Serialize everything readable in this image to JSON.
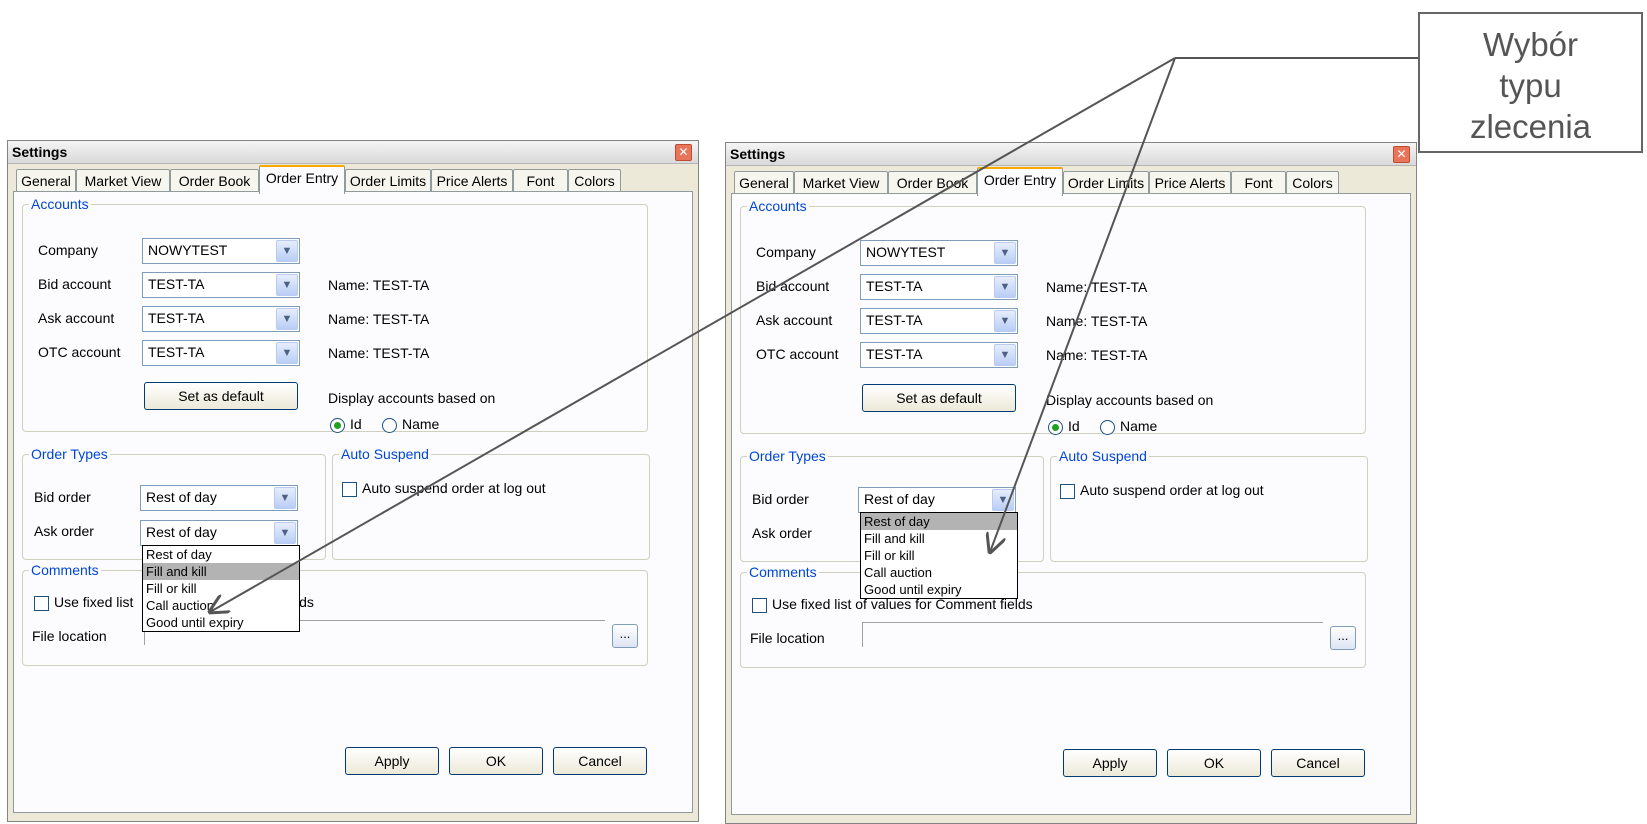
{
  "callout": {
    "line1": "Wybór",
    "line2": "typu",
    "line3": "zlecenia"
  },
  "dialogs": [
    {
      "title": "Settings",
      "close_glyph": "✕",
      "tabs": [
        "General",
        "Market View",
        "Order Book",
        "Order Entry",
        "Order Limits",
        "Price Alerts",
        "Font",
        "Colors"
      ],
      "active_tab": "Order Entry",
      "accounts": {
        "legend": "Accounts",
        "company_label": "Company",
        "company_value": "NOWYTEST",
        "bid_label": "Bid account",
        "bid_value": "TEST-TA",
        "bid_name": "Name: TEST-TA",
        "ask_label": "Ask account",
        "ask_value": "TEST-TA",
        "ask_name": "Name: TEST-TA",
        "otc_label": "OTC account",
        "otc_value": "TEST-TA",
        "otc_name": "Name: TEST-TA",
        "set_default": "Set as default",
        "display_label": "Display accounts based on",
        "radio_id": "Id",
        "radio_name": "Name",
        "selected": "Id"
      },
      "order_types": {
        "legend": "Order Types",
        "bid_label": "Bid order",
        "bid_value": "Rest of day",
        "ask_label": "Ask order",
        "ask_value": "Rest of day",
        "open_dropdown": "ask",
        "options": [
          "Rest of day",
          "Fill and kill",
          "Fill or kill",
          "Call auction",
          "Good until expiry"
        ],
        "highlighted": "Fill and kill"
      },
      "auto_suspend": {
        "legend": "Auto Suspend",
        "checkbox": "Auto suspend order at log out",
        "checked": false
      },
      "comments": {
        "legend": "Comments",
        "checkbox": "Use fixed list of values for Comment fields",
        "checkbox_visible_tail": "lds",
        "checked": false,
        "file_label": "File location",
        "file_value": "",
        "browse": "..."
      },
      "buttons": {
        "apply": "Apply",
        "ok": "OK",
        "cancel": "Cancel"
      }
    },
    {
      "title": "Settings",
      "close_glyph": "✕",
      "tabs": [
        "General",
        "Market View",
        "Order Book",
        "Order Entry",
        "Order Limits",
        "Price Alerts",
        "Font",
        "Colors"
      ],
      "active_tab": "Order Entry",
      "accounts": {
        "legend": "Accounts",
        "company_label": "Company",
        "company_value": "NOWYTEST",
        "bid_label": "Bid account",
        "bid_value": "TEST-TA",
        "bid_name": "Name: TEST-TA",
        "ask_label": "Ask account",
        "ask_value": "TEST-TA",
        "ask_name": "Name: TEST-TA",
        "otc_label": "OTC account",
        "otc_value": "TEST-TA",
        "otc_name": "Name: TEST-TA",
        "set_default": "Set as default",
        "display_label": "Display accounts based on",
        "radio_id": "Id",
        "radio_name": "Name",
        "selected": "Id"
      },
      "order_types": {
        "legend": "Order Types",
        "bid_label": "Bid order",
        "bid_value": "Rest of day",
        "ask_label": "Ask order",
        "ask_value": "",
        "open_dropdown": "bid",
        "options": [
          "Rest of day",
          "Fill and kill",
          "Fill or kill",
          "Call auction",
          "Good until expiry"
        ],
        "highlighted": "Rest of day"
      },
      "auto_suspend": {
        "legend": "Auto Suspend",
        "checkbox": "Auto suspend order at log out",
        "checked": false
      },
      "comments": {
        "legend": "Comments",
        "checkbox": "Use fixed list of values for Comment fields",
        "checkbox_visible_tail": "",
        "checked": false,
        "file_label": "File location",
        "file_value": "",
        "browse": "..."
      },
      "buttons": {
        "apply": "Apply",
        "ok": "OK",
        "cancel": "Cancel"
      }
    }
  ],
  "colors": {
    "legend_blue": "#0046d5",
    "tab_active_border": "#f8a900",
    "dialog_bg": "#ece9d8",
    "highlight": "#b3b3b3"
  }
}
